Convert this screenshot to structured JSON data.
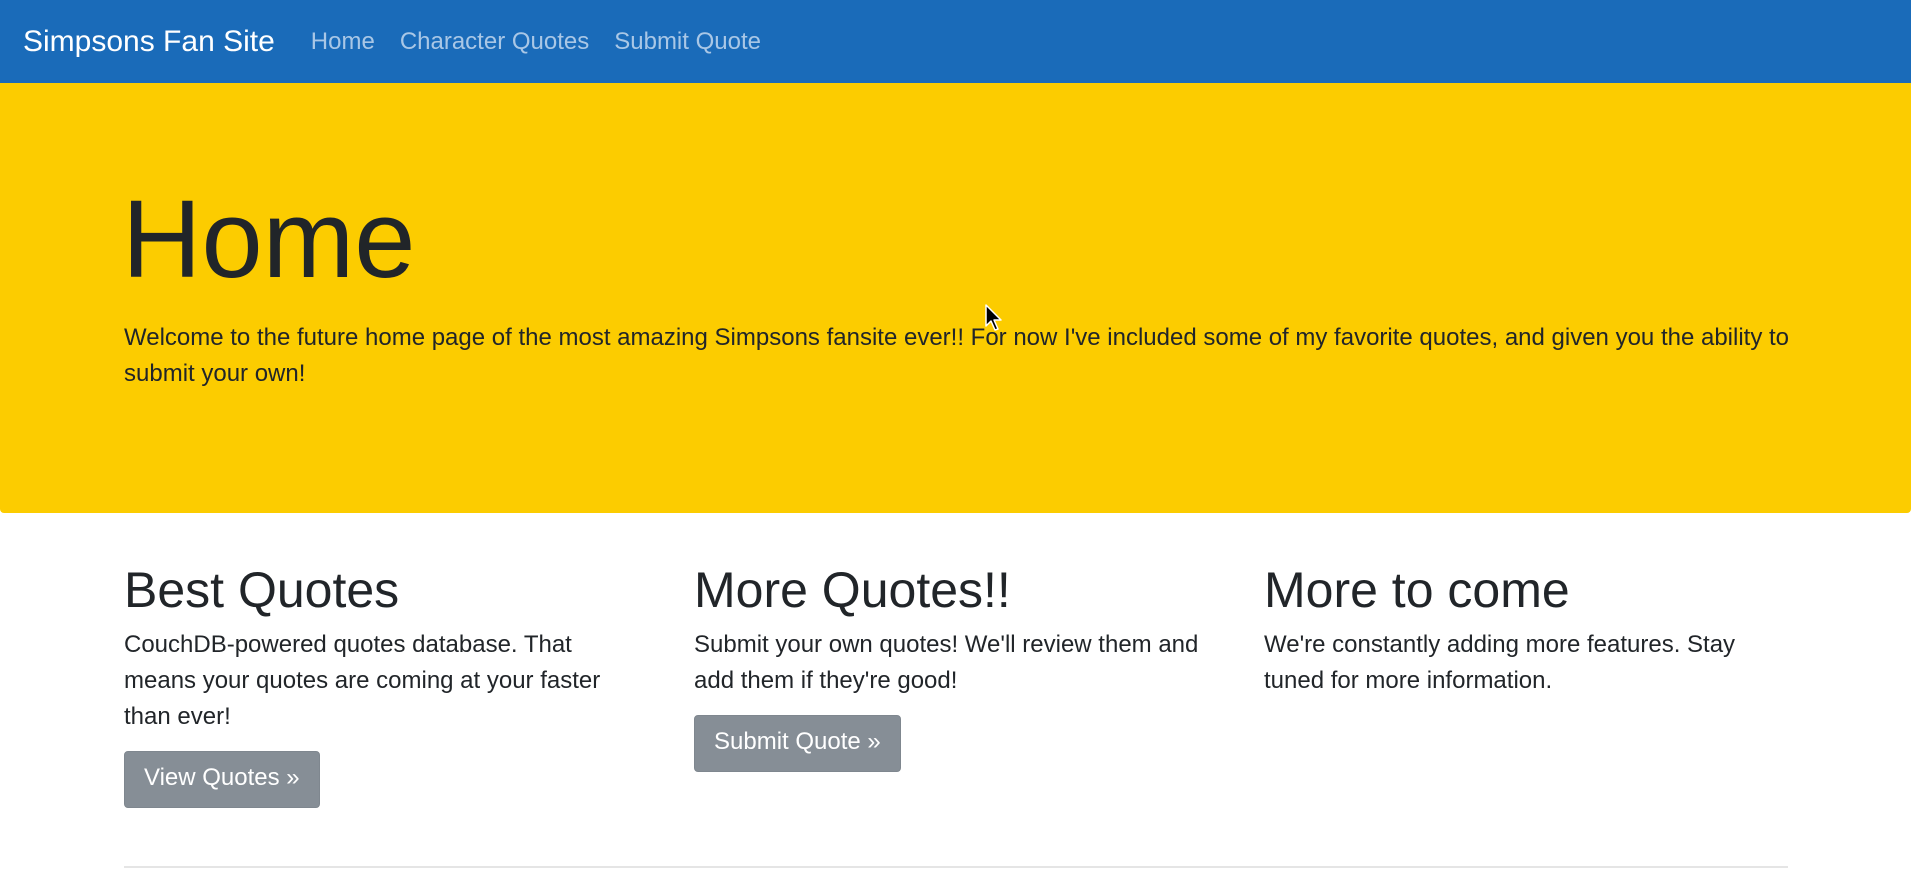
{
  "navbar": {
    "brand": "Simpsons Fan Site",
    "links": [
      {
        "label": "Home"
      },
      {
        "label": "Character Quotes"
      },
      {
        "label": "Submit Quote"
      }
    ]
  },
  "jumbotron": {
    "title": "Home",
    "lead": "Welcome to the future home page of the most amazing Simpsons fansite ever!! For now I've included some of my favorite quotes, and given you the ability to submit your own!"
  },
  "features": [
    {
      "heading": "Best Quotes",
      "text": "CouchDB-powered quotes database. That means your quotes are coming at your faster than ever!",
      "button": "View Quotes »"
    },
    {
      "heading": "More Quotes!!",
      "text": "Submit your own quotes! We'll review them and add them if they're good!",
      "button": "Submit Quote »"
    },
    {
      "heading": "More to come",
      "text": "We're constantly adding more features. Stay tuned for more information."
    }
  ],
  "colors": {
    "navbar": "#1a6bb9",
    "jumbotron": "#fccc00",
    "button": "#868e96"
  }
}
